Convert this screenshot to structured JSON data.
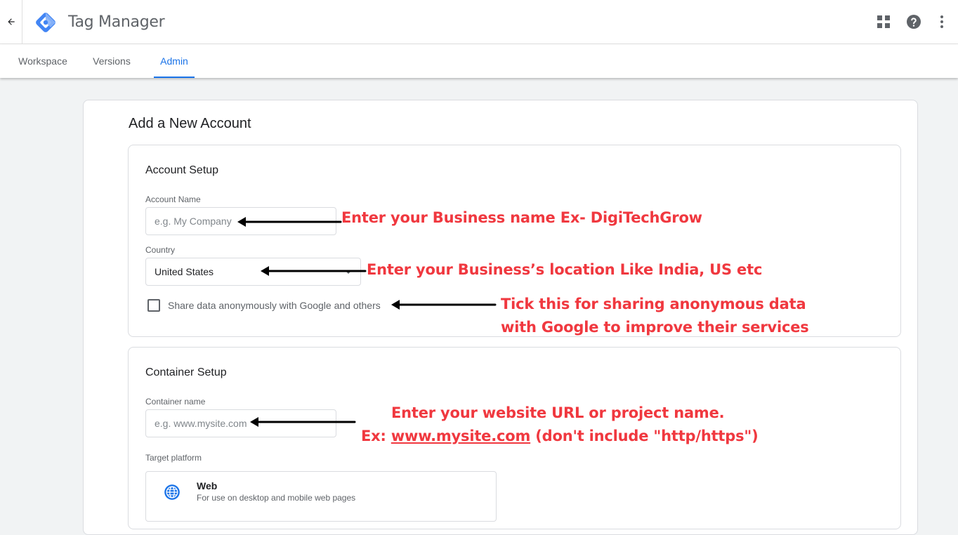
{
  "app": {
    "title": "Tag Manager"
  },
  "tabs": [
    {
      "label": "Workspace"
    },
    {
      "label": "Versions"
    },
    {
      "label": "Admin"
    }
  ],
  "page": {
    "title": "Add a New Account"
  },
  "account_setup": {
    "title": "Account Setup",
    "account_name": {
      "label": "Account Name",
      "placeholder": "e.g. My Company",
      "value": ""
    },
    "country": {
      "label": "Country",
      "value": "United States"
    },
    "share_data": {
      "label": "Share data anonymously with Google and others",
      "checked": false
    }
  },
  "container_setup": {
    "title": "Container Setup",
    "container_name": {
      "label": "Container name",
      "placeholder": "e.g. www.mysite.com",
      "value": ""
    },
    "target_platform": {
      "label": "Target platform",
      "options": [
        {
          "name": "Web",
          "description": "For use on desktop and mobile web pages",
          "icon": "globe-icon"
        }
      ]
    }
  },
  "annotations": {
    "business_name": "Enter your Business name  Ex- DigiTechGrow",
    "business_location": "Enter your Business’s location  Like  India, US etc",
    "share_line1": "Tick this for sharing anonymous data",
    "share_line2": "with Google to improve their services",
    "website_line1": "Enter your website URL or project name.",
    "website_prefix": "Ex: ",
    "website_link": "www.mysite.com",
    "website_suffix": " (don't include \"http/https\")"
  },
  "icons": {
    "back": "arrow-back-icon",
    "logo": "tag-manager-logo",
    "apps": "apps-grid-icon",
    "help": "help-icon",
    "more": "more-vert-icon"
  },
  "colors": {
    "accent": "#1a73e8",
    "annotation": "#f0383f",
    "logo_dark": "#4285f4",
    "logo_light": "#8ab4f8"
  }
}
